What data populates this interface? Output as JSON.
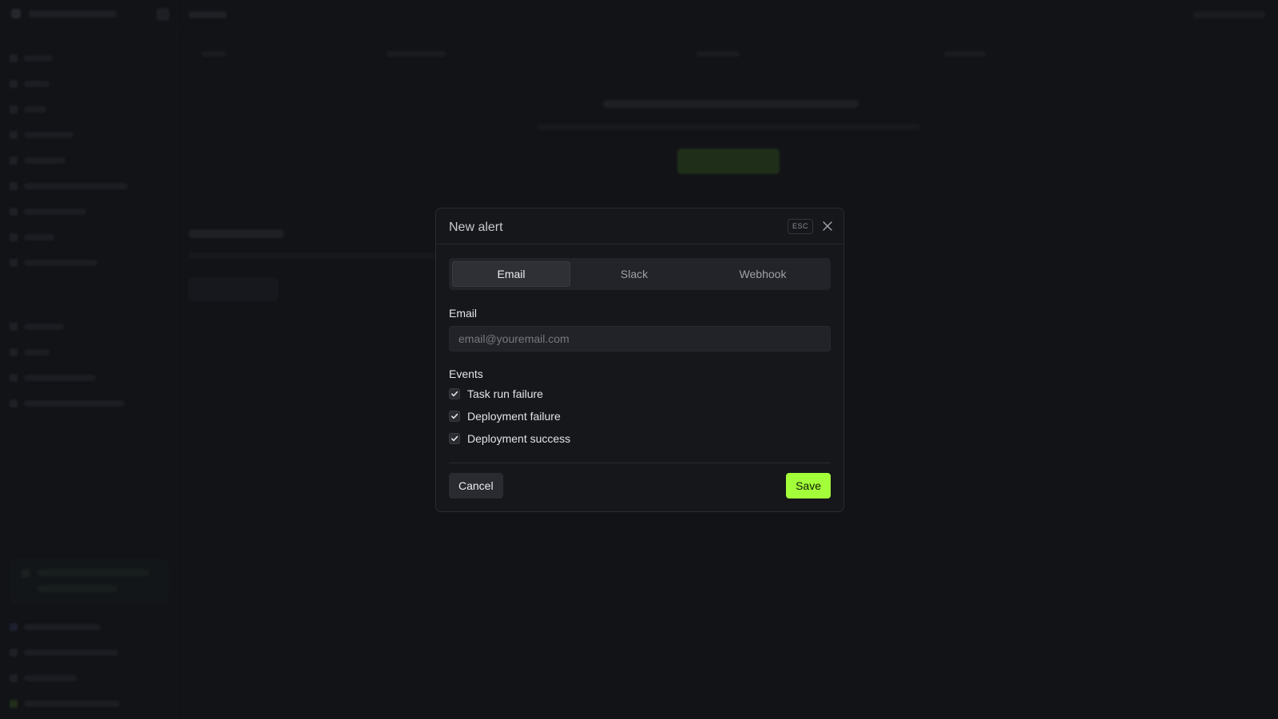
{
  "modal": {
    "title": "New alert",
    "esc_label": "ESC",
    "tabs": [
      {
        "label": "Email",
        "active": true
      },
      {
        "label": "Slack",
        "active": false
      },
      {
        "label": "Webhook",
        "active": false
      }
    ],
    "email": {
      "label": "Email",
      "value": "",
      "placeholder": "email@youremail.com"
    },
    "events": {
      "label": "Events",
      "items": [
        {
          "label": "Task run failure",
          "checked": true
        },
        {
          "label": "Deployment failure",
          "checked": true
        },
        {
          "label": "Deployment success",
          "checked": true
        }
      ]
    },
    "cancel_label": "Cancel",
    "save_label": "Save"
  },
  "colors": {
    "accent": "#a3ff39",
    "background": "#121317",
    "modal_bg": "#16171b"
  },
  "icons": {
    "close": "close-icon",
    "check": "check-icon"
  }
}
